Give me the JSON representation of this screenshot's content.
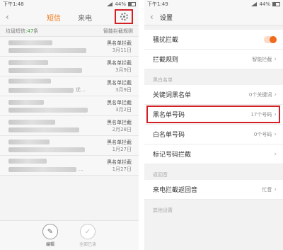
{
  "left": {
    "status": {
      "time": "下午1:48",
      "battery": "44%"
    },
    "tabs": [
      {
        "label": "短信"
      },
      {
        "label": "来电"
      }
    ],
    "spam": {
      "prefix": "垃圾短信:",
      "count": "47",
      "suffix": "条",
      "rules": "智能拦截规则"
    },
    "messages": [
      {
        "tag": "黑名单拦截",
        "date": "3月11日",
        "extra": ""
      },
      {
        "tag": "黑名单拦截",
        "date": "3月9日",
        "extra": ""
      },
      {
        "tag": "黑名单拦截",
        "date": "3月9日",
        "extra": "优..."
      },
      {
        "tag": "黑名单拦截",
        "date": "3月2日",
        "extra": ""
      },
      {
        "tag": "黑名单拦截",
        "date": "2月28日",
        "extra": ""
      },
      {
        "tag": "黑名单拦截",
        "date": "1月27日",
        "extra": ""
      },
      {
        "tag": "黑名单拦截",
        "date": "1月27日",
        "extra": "..."
      }
    ],
    "bottom": {
      "edit": "编辑",
      "mark_read": "全部已读"
    }
  },
  "right": {
    "status": {
      "time": "下午1:49",
      "battery": "44%"
    },
    "title": "设置",
    "harass": {
      "label": "骚扰拦截"
    },
    "rules": {
      "label": "拦截规则",
      "value": "智能拦截"
    },
    "blacklist_section": "黑白名单",
    "keyword_blacklist": {
      "label": "关键词黑名单",
      "value": "0个关键词"
    },
    "number_blacklist": {
      "label": "黑名单号码",
      "value": "17个号码"
    },
    "whitelist": {
      "label": "白名单号码",
      "value": "0个号码"
    },
    "marked": {
      "label": "标记号码拦截"
    },
    "ringback_section": "返回音",
    "ringback": {
      "label": "来电拦截返回音",
      "value": "忙音"
    },
    "other_section": "其他设置"
  },
  "colors": {
    "accent": "#f07b1e",
    "highlight": "#d32027",
    "count": "#3aa63a"
  }
}
